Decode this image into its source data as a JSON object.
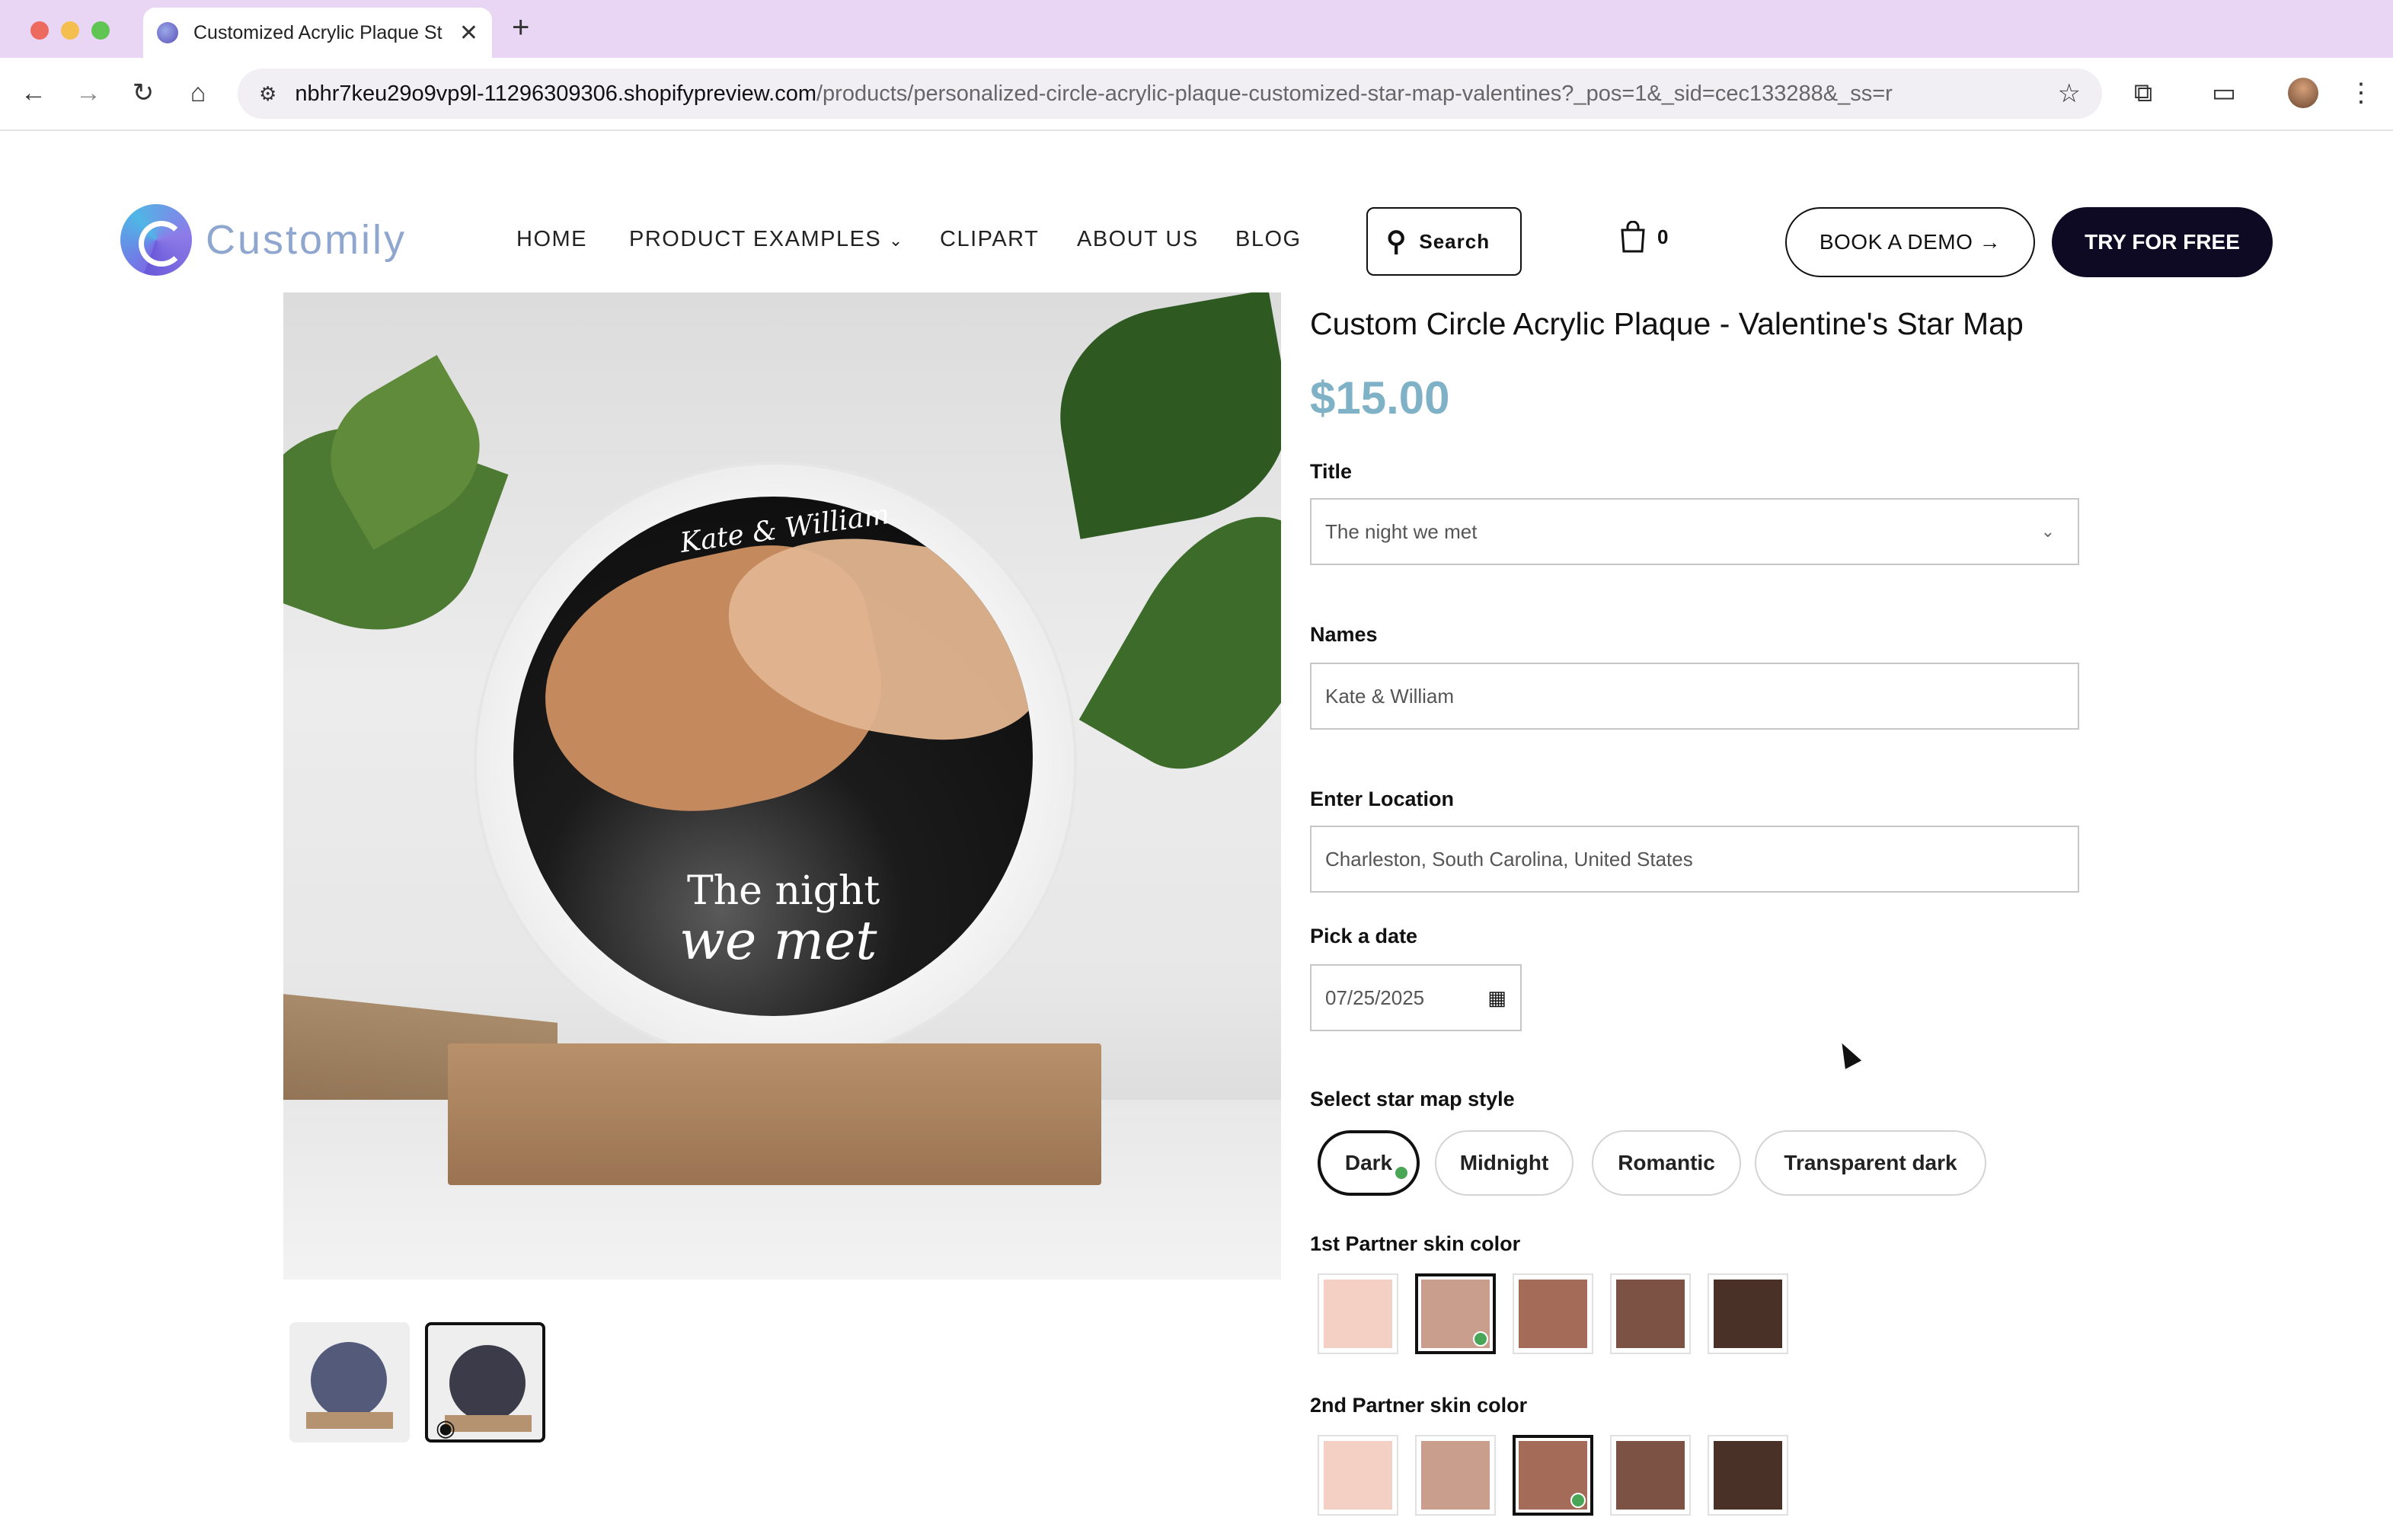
{
  "browser": {
    "tab_title": "Customized Acrylic Plaque St",
    "url_host": "nbhr7keu29o9vp9l-11296309306.shopifypreview.com",
    "url_path": "/products/personalized-circle-acrylic-plaque-customized-star-map-valentines?_pos=1&_sid=cec133288&_ss=r"
  },
  "header": {
    "logo_text": "Customily",
    "nav": [
      "HOME",
      "PRODUCT EXAMPLES",
      "CLIPART",
      "ABOUT US",
      "BLOG"
    ],
    "search_label": "Search",
    "cart_count": "0",
    "demo_label": "BOOK A DEMO →",
    "try_label": "TRY FOR FREE"
  },
  "product": {
    "title": "Custom Circle Acrylic Plaque - Valentine's Star Map",
    "price": "$15.00",
    "image_names_text": "Kate & William",
    "image_quote_line1": "The night",
    "image_quote_line2": "we met"
  },
  "form": {
    "title_label": "Title",
    "title_value": "The night we met",
    "names_label": "Names",
    "names_value": "Kate & William",
    "location_label": "Enter Location",
    "location_value": "Charleston, South Carolina, United States",
    "date_label": "Pick a date",
    "date_value": "07/25/2025",
    "style_label": "Select star map style",
    "styles": [
      "Dark",
      "Midnight",
      "Romantic",
      "Transparent dark"
    ],
    "selected_style": "Dark",
    "partner1_label": "1st Partner skin color",
    "partner2_label": "2nd Partner skin color",
    "skin_colors": [
      "#f4d0c4",
      "#c99e8c",
      "#a46b58",
      "#7b5243",
      "#4a3128"
    ],
    "partner1_selected_index": 1,
    "partner2_selected_index": 2
  },
  "colors": {
    "price": "#7fb2c6",
    "primary_button": "#0f0a24",
    "check": "#4aa657"
  }
}
